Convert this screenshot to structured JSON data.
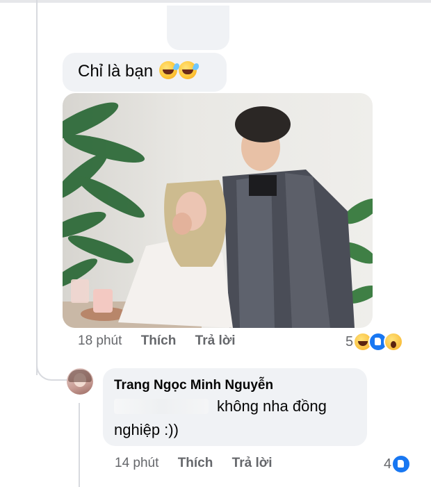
{
  "comment": {
    "text": "Chỉ là bạn",
    "emojis": [
      "rolling-on-floor-laughing",
      "rolling-on-floor-laughing"
    ],
    "time": "18 phút",
    "like_label": "Thích",
    "reply_label": "Trả lời",
    "reaction_count": "5",
    "reactions": [
      "haha",
      "like",
      "wow"
    ]
  },
  "reply": {
    "author": "Trang Ngọc Minh Nguyễn",
    "line1": "không nha đồng",
    "line2": "nghiệp :))",
    "time": "14 phút",
    "like_label": "Thích",
    "reply_label": "Trả lời",
    "reaction_count": "4",
    "reactions": [
      "like"
    ]
  },
  "colors": {
    "bubble": "#f0f2f5",
    "meta_text": "#65676b",
    "like_blue": "#1877f2"
  }
}
